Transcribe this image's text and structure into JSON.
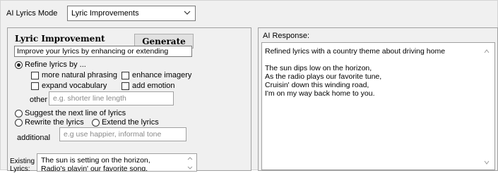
{
  "header": {
    "mode_label": "AI Lyrics Mode",
    "mode_value": "Lyric Improvements"
  },
  "left": {
    "title": "Lyric Improvement",
    "generate_label": "Generate",
    "description": "Improve your lyrics by enhancing or extending",
    "refine_label": "Refine lyrics by ...",
    "options": {
      "natural_phrasing": "more natural phrasing",
      "enhance_imagery": "enhance imagery",
      "expand_vocabulary": "expand vocabulary",
      "add_emotion": "add emotion"
    },
    "other_label": "other",
    "other_placeholder": "e.g. shorter line length",
    "suggest_label": "Suggest the next line of lyrics",
    "rewrite_label": "Rewrite the lyrics",
    "extend_label": "Extend the lyrics",
    "additional_label": "additional",
    "additional_placeholder": "e.g use happier, informal tone",
    "existing_label_1": "Existing",
    "existing_label_2": "Lyrics:",
    "existing_lines": [
      "The sun is setting on the horizon,",
      "Radio's playin' our favorite song,"
    ]
  },
  "right": {
    "response_label": "AI Response:",
    "response_heading": "Refined lyrics with a country theme about driving home",
    "response_lines": [
      "The sun dips low on the horizon,",
      "As the radio plays our favorite tune,",
      "Cruisin' down this winding road,",
      "I'm on my way back home to you."
    ]
  },
  "icons": {
    "dropdown": "chevron-down-icon",
    "scroll_up": "scroll-up-arrow-icon",
    "scroll_down": "scroll-down-arrow-icon"
  }
}
